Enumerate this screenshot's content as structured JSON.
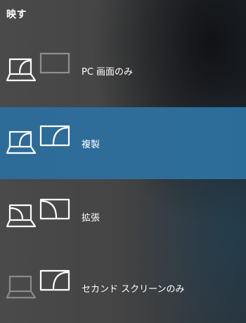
{
  "header": {
    "title": "映す"
  },
  "options": [
    {
      "label": "PC 画面のみ",
      "selected": false,
      "icon": "pc-screen-only-icon"
    },
    {
      "label": "複製",
      "selected": true,
      "icon": "duplicate-icon"
    },
    {
      "label": "拡張",
      "selected": false,
      "icon": "extend-icon"
    },
    {
      "label": "セカンド スクリーンのみ",
      "selected": false,
      "icon": "second-screen-only-icon"
    }
  ],
  "colors": {
    "selected_background": "#2d6b98",
    "active_stroke": "#ffffff",
    "inactive_stroke": "#8a8a8a"
  }
}
